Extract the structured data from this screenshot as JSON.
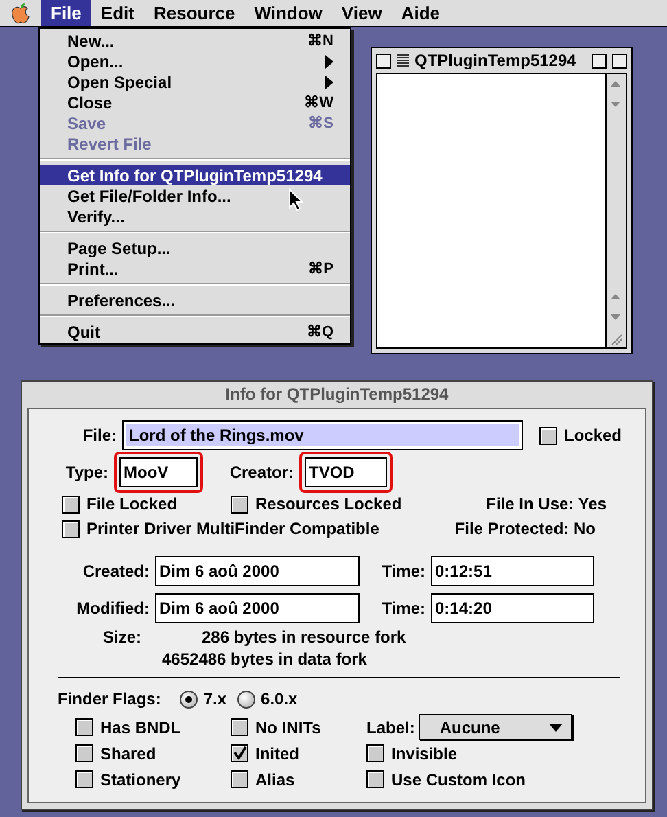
{
  "menubar": {
    "items": [
      {
        "label": "File",
        "selected": true
      },
      {
        "label": "Edit",
        "selected": false
      },
      {
        "label": "Resource",
        "selected": false
      },
      {
        "label": "Window",
        "selected": false
      },
      {
        "label": "View",
        "selected": false
      },
      {
        "label": "Aide",
        "selected": false
      }
    ]
  },
  "file_menu": {
    "groups": [
      [
        {
          "label": "New...",
          "shortcut": "⌘N",
          "submenu": false,
          "disabled": false,
          "selected": false
        },
        {
          "label": "Open...",
          "submenu": true,
          "disabled": false,
          "selected": false
        },
        {
          "label": "Open Special",
          "submenu": true,
          "disabled": false,
          "selected": false
        },
        {
          "label": "Close",
          "shortcut": "⌘W",
          "submenu": false,
          "disabled": false,
          "selected": false
        },
        {
          "label": "Save",
          "shortcut": "⌘S",
          "submenu": false,
          "disabled": true,
          "selected": false
        },
        {
          "label": "Revert File",
          "submenu": false,
          "disabled": true,
          "selected": false
        }
      ],
      [
        {
          "label": "Get Info for QTPluginTemp51294",
          "submenu": false,
          "disabled": false,
          "selected": true
        },
        {
          "label": "Get File/Folder Info...",
          "submenu": false,
          "disabled": false,
          "selected": false
        },
        {
          "label": "Verify...",
          "submenu": false,
          "disabled": false,
          "selected": false
        }
      ],
      [
        {
          "label": "Page Setup...",
          "submenu": false,
          "disabled": false,
          "selected": false
        },
        {
          "label": "Print...",
          "shortcut": "⌘P",
          "submenu": false,
          "disabled": false,
          "selected": false
        }
      ],
      [
        {
          "label": "Preferences...",
          "submenu": false,
          "disabled": false,
          "selected": false
        }
      ],
      [
        {
          "label": "Quit",
          "shortcut": "⌘Q",
          "submenu": false,
          "disabled": false,
          "selected": false
        }
      ]
    ]
  },
  "document_window": {
    "title": "QTPluginTemp51294"
  },
  "info_window": {
    "title": "Info for QTPluginTemp51294",
    "file": {
      "label": "File:",
      "value": "Lord of the Rings.mov"
    },
    "locked": {
      "label": "Locked",
      "checked": false
    },
    "type": {
      "label": "Type:",
      "value": "MooV",
      "highlighted": true
    },
    "creator": {
      "label": "Creator:",
      "value": "TVOD",
      "highlighted": true
    },
    "file_locked": {
      "label": "File Locked",
      "checked": false
    },
    "resources_locked": {
      "label": "Resources Locked",
      "checked": false
    },
    "file_in_use": {
      "label": "File In Use:",
      "value": "Yes"
    },
    "printer_driver": {
      "label": "Printer Driver MultiFinder Compatible",
      "checked": false
    },
    "file_protected": {
      "label": "File Protected:",
      "value": "No"
    },
    "dates": [
      {
        "label": "Created:",
        "date": "Dim 6 aoû 2000",
        "time_label": "Time:",
        "time": "0:12:51"
      },
      {
        "label": "Modified:",
        "date": "Dim 6 aoû 2000",
        "time_label": "Time:",
        "time": "0:14:20"
      }
    ],
    "size": {
      "label": "Size:",
      "lines": [
        "286 bytes in resource fork",
        "4652486 bytes in data fork"
      ]
    },
    "finder_flags": {
      "label": "Finder Flags:",
      "options": [
        {
          "label": "7.x",
          "selected": true
        },
        {
          "label": "6.0.x",
          "selected": false
        }
      ]
    },
    "flags": [
      {
        "label": "Has BNDL",
        "checked": false
      },
      {
        "label": "No INITs",
        "checked": false
      },
      {
        "label": "Shared",
        "checked": false
      },
      {
        "label": "Inited",
        "checked": true
      },
      {
        "label": "Stationery",
        "checked": false
      },
      {
        "label": "Alias",
        "checked": false
      }
    ],
    "label": {
      "label": "Label:",
      "value": "Aucune"
    },
    "more_flags": [
      {
        "label": "Invisible",
        "checked": false
      },
      {
        "label": "Use Custom Icon",
        "checked": false
      }
    ]
  }
}
